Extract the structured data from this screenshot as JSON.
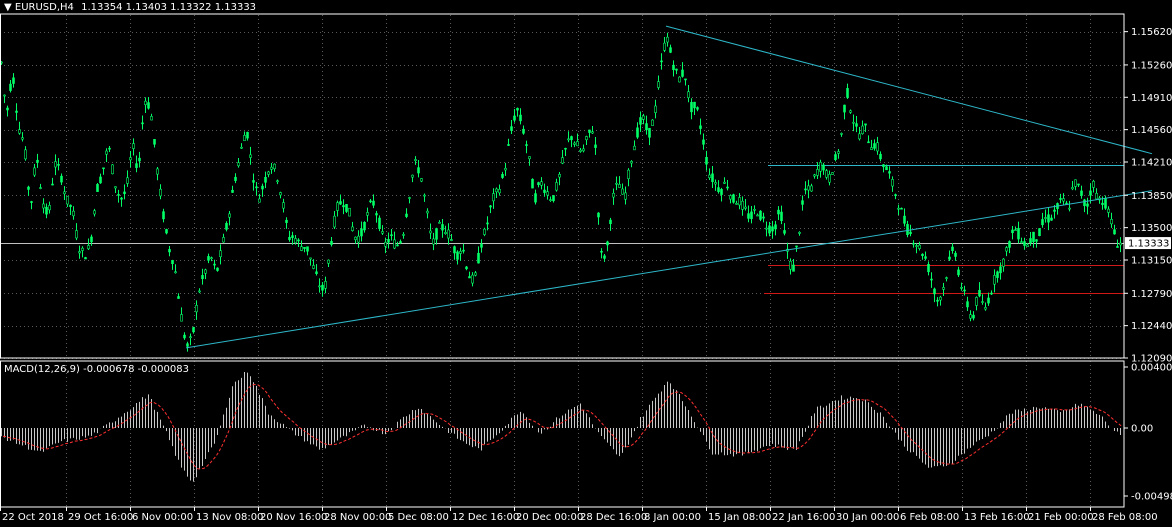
{
  "main_header": {
    "arrow": "▼",
    "symbol": "EURUSD,H4",
    "ohlc": "1.13354 1.13403 1.13322 1.13333"
  },
  "macd_header": {
    "label": "MACD(12,26,9) -0.000678 -0.000083"
  },
  "colors": {
    "background": "#000000",
    "frame": "#ffffff",
    "grid": "#5a5a5a",
    "candles": "#00ff66",
    "trendline": "#2db7c9",
    "resistance": "#2db7c9",
    "support": "#d01818",
    "current_price_line": "#c0c0c0",
    "macd_hist": "#c8c8c8",
    "macd_signal": "#ff3030"
  },
  "price_axis": {
    "ticks": [
      "1.15620",
      "1.15260",
      "1.14910",
      "1.14560",
      "1.14210",
      "1.13850",
      "1.13500",
      "1.13150",
      "1.12790",
      "1.12440",
      "1.12090"
    ],
    "current_price": "1.13333"
  },
  "macd_axis": {
    "ticks": [
      "0.004009",
      "0.00",
      "-0.00498"
    ]
  },
  "time_axis": {
    "labels": [
      "22 Oct 2018",
      "29 Oct 16:00",
      "6 Nov 00:00",
      "13 Nov 08:00",
      "20 Nov 16:00",
      "28 Nov 00:00",
      "5 Dec 08:00",
      "12 Dec 16:00",
      "20 Dec 00:00",
      "28 Dec 16:00",
      "8 Jan 00:00",
      "15 Jan 08:00",
      "22 Jan 16:00",
      "30 Jan 00:00",
      "6 Feb 08:00",
      "13 Feb 16:00",
      "21 Feb 00:00",
      "28 Feb 08:00"
    ]
  },
  "chart_data": {
    "type": "candlestick",
    "symbol": "EURUSD",
    "timeframe": "H4",
    "ylim": [
      1.1209,
      1.158
    ],
    "price_path": [
      [
        0,
        1.154
      ],
      [
        6,
        1.147
      ],
      [
        12,
        1.152
      ],
      [
        18,
        1.146
      ],
      [
        24,
        1.144
      ],
      [
        30,
        1.137
      ],
      [
        36,
        1.143
      ],
      [
        42,
        1.138
      ],
      [
        48,
        1.136
      ],
      [
        54,
        1.142
      ],
      [
        60,
        1.141
      ],
      [
        66,
        1.138
      ],
      [
        72,
        1.137
      ],
      [
        78,
        1.133
      ],
      [
        84,
        1.132
      ],
      [
        90,
        1.133
      ],
      [
        96,
        1.139
      ],
      [
        102,
        1.141
      ],
      [
        108,
        1.144
      ],
      [
        114,
        1.14
      ],
      [
        120,
        1.138
      ],
      [
        126,
        1.139
      ],
      [
        132,
        1.144
      ],
      [
        138,
        1.141
      ],
      [
        144,
        1.149
      ],
      [
        150,
        1.148
      ],
      [
        156,
        1.142
      ],
      [
        162,
        1.137
      ],
      [
        168,
        1.133
      ],
      [
        174,
        1.131
      ],
      [
        180,
        1.126
      ],
      [
        186,
        1.122
      ],
      [
        192,
        1.123
      ],
      [
        198,
        1.128
      ],
      [
        204,
        1.13
      ],
      [
        210,
        1.132
      ],
      [
        216,
        1.13
      ],
      [
        222,
        1.133
      ],
      [
        228,
        1.136
      ],
      [
        234,
        1.14
      ],
      [
        240,
        1.143
      ],
      [
        246,
        1.146
      ],
      [
        252,
        1.141
      ],
      [
        258,
        1.138
      ],
      [
        264,
        1.14
      ],
      [
        270,
        1.142
      ],
      [
        276,
        1.141
      ],
      [
        282,
        1.138
      ],
      [
        288,
        1.134
      ],
      [
        294,
        1.134
      ],
      [
        300,
        1.133
      ],
      [
        306,
        1.133
      ],
      [
        312,
        1.131
      ],
      [
        318,
        1.129
      ],
      [
        324,
        1.128
      ],
      [
        330,
        1.133
      ],
      [
        336,
        1.137
      ],
      [
        342,
        1.138
      ],
      [
        348,
        1.137
      ],
      [
        354,
        1.134
      ],
      [
        360,
        1.134
      ],
      [
        366,
        1.136
      ],
      [
        372,
        1.138
      ],
      [
        378,
        1.136
      ],
      [
        384,
        1.133
      ],
      [
        390,
        1.134
      ],
      [
        396,
        1.133
      ],
      [
        402,
        1.134
      ],
      [
        408,
        1.138
      ],
      [
        414,
        1.142
      ],
      [
        420,
        1.141
      ],
      [
        426,
        1.137
      ],
      [
        432,
        1.133
      ],
      [
        438,
        1.135
      ],
      [
        444,
        1.135
      ],
      [
        450,
        1.134
      ],
      [
        456,
        1.132
      ],
      [
        462,
        1.133
      ],
      [
        468,
        1.13
      ],
      [
        474,
        1.129
      ],
      [
        480,
        1.133
      ],
      [
        486,
        1.135
      ],
      [
        492,
        1.138
      ],
      [
        498,
        1.139
      ],
      [
        504,
        1.141
      ],
      [
        510,
        1.145
      ],
      [
        516,
        1.148
      ],
      [
        522,
        1.146
      ],
      [
        528,
        1.143
      ],
      [
        534,
        1.138
      ],
      [
        540,
        1.14
      ],
      [
        546,
        1.139
      ],
      [
        552,
        1.138
      ],
      [
        558,
        1.14
      ],
      [
        564,
        1.143
      ],
      [
        570,
        1.145
      ],
      [
        576,
        1.144
      ],
      [
        582,
        1.143
      ],
      [
        588,
        1.145
      ],
      [
        594,
        1.146
      ],
      [
        600,
        1.132
      ],
      [
        606,
        1.132
      ],
      [
        612,
        1.138
      ],
      [
        618,
        1.14
      ],
      [
        624,
        1.138
      ],
      [
        630,
        1.142
      ],
      [
        636,
        1.145
      ],
      [
        642,
        1.147
      ],
      [
        648,
        1.145
      ],
      [
        654,
        1.147
      ],
      [
        660,
        1.152
      ],
      [
        666,
        1.156
      ],
      [
        672,
        1.153
      ],
      [
        678,
        1.151
      ],
      [
        684,
        1.152
      ],
      [
        690,
        1.148
      ],
      [
        696,
        1.148
      ],
      [
        702,
        1.145
      ],
      [
        708,
        1.141
      ],
      [
        714,
        1.14
      ],
      [
        720,
        1.139
      ],
      [
        726,
        1.14
      ],
      [
        732,
        1.138
      ],
      [
        738,
        1.138
      ],
      [
        744,
        1.137
      ],
      [
        750,
        1.136
      ],
      [
        756,
        1.137
      ],
      [
        762,
        1.136
      ],
      [
        768,
        1.135
      ],
      [
        774,
        1.135
      ],
      [
        780,
        1.137
      ],
      [
        786,
        1.133
      ],
      [
        792,
        1.13
      ],
      [
        798,
        1.134
      ],
      [
        804,
        1.139
      ],
      [
        810,
        1.139
      ],
      [
        816,
        1.141
      ],
      [
        822,
        1.142
      ],
      [
        828,
        1.14
      ],
      [
        834,
        1.142
      ],
      [
        840,
        1.144
      ],
      [
        846,
        1.15
      ],
      [
        852,
        1.147
      ],
      [
        858,
        1.145
      ],
      [
        864,
        1.146
      ],
      [
        870,
        1.144
      ],
      [
        876,
        1.144
      ],
      [
        882,
        1.142
      ],
      [
        888,
        1.141
      ],
      [
        894,
        1.139
      ],
      [
        900,
        1.137
      ],
      [
        906,
        1.135
      ],
      [
        912,
        1.134
      ],
      [
        918,
        1.133
      ],
      [
        924,
        1.132
      ],
      [
        930,
        1.13
      ],
      [
        936,
        1.127
      ],
      [
        942,
        1.128
      ],
      [
        948,
        1.131
      ],
      [
        954,
        1.133
      ],
      [
        960,
        1.129
      ],
      [
        966,
        1.127
      ],
      [
        972,
        1.125
      ],
      [
        978,
        1.128
      ],
      [
        984,
        1.126
      ],
      [
        990,
        1.128
      ],
      [
        996,
        1.13
      ],
      [
        1002,
        1.131
      ],
      [
        1008,
        1.133
      ],
      [
        1014,
        1.135
      ],
      [
        1020,
        1.134
      ],
      [
        1026,
        1.133
      ],
      [
        1032,
        1.134
      ],
      [
        1038,
        1.134
      ],
      [
        1044,
        1.136
      ],
      [
        1050,
        1.136
      ],
      [
        1056,
        1.137
      ],
      [
        1062,
        1.138
      ],
      [
        1068,
        1.137
      ],
      [
        1074,
        1.14
      ],
      [
        1080,
        1.139
      ],
      [
        1086,
        1.137
      ],
      [
        1092,
        1.14
      ],
      [
        1098,
        1.138
      ],
      [
        1104,
        1.138
      ],
      [
        1110,
        1.136
      ],
      [
        1116,
        1.1335
      ],
      [
        1120,
        1.1333
      ]
    ],
    "trendlines": [
      {
        "name": "lower-trendline",
        "points": [
          [
            186,
            1.122
          ],
          [
            1152,
            1.139
          ]
        ]
      },
      {
        "name": "upper-trendline",
        "points": [
          [
            666,
            1.1568
          ],
          [
            1152,
            1.143
          ]
        ]
      }
    ],
    "horizontal_levels": [
      {
        "name": "resistance-line",
        "price": 1.1418,
        "x_from": 768
      },
      {
        "name": "support-line-upper",
        "price": 1.131,
        "x_from": 768
      },
      {
        "name": "support-line-lower",
        "price": 1.1279,
        "x_from": 764
      },
      {
        "name": "current-price-line",
        "price": 1.13333,
        "x_from": 0
      }
    ],
    "macd": {
      "ylim": [
        -0.00498,
        0.004009
      ],
      "hist_path": [
        [
          0,
          -0.0006
        ],
        [
          40,
          -0.0018
        ],
        [
          60,
          -0.001
        ],
        [
          90,
          -0.0006
        ],
        [
          120,
          0.0008
        ],
        [
          148,
          0.0022
        ],
        [
          165,
          -0.0002
        ],
        [
          180,
          -0.0028
        ],
        [
          192,
          -0.004
        ],
        [
          215,
          -0.001
        ],
        [
          232,
          0.0028
        ],
        [
          248,
          0.0038
        ],
        [
          268,
          0.001
        ],
        [
          290,
          -0.0002
        ],
        [
          320,
          -0.0016
        ],
        [
          345,
          -0.0006
        ],
        [
          365,
          0.0002
        ],
        [
          385,
          -0.0004
        ],
        [
          405,
          0.0008
        ],
        [
          418,
          0.0014
        ],
        [
          440,
          0.0002
        ],
        [
          462,
          -0.001
        ],
        [
          480,
          -0.0016
        ],
        [
          500,
          -0.0002
        ],
        [
          520,
          0.0012
        ],
        [
          540,
          -0.0004
        ],
        [
          560,
          0.0008
        ],
        [
          580,
          0.0016
        ],
        [
          600,
          -0.0006
        ],
        [
          620,
          -0.0022
        ],
        [
          640,
          0.0006
        ],
        [
          668,
          0.0032
        ],
        [
          690,
          0.001
        ],
        [
          712,
          -0.0018
        ],
        [
          740,
          -0.002
        ],
        [
          770,
          -0.0012
        ],
        [
          795,
          -0.0016
        ],
        [
          815,
          0.0012
        ],
        [
          840,
          0.002
        ],
        [
          860,
          0.002
        ],
        [
          880,
          0.001
        ],
        [
          905,
          -0.0014
        ],
        [
          930,
          -0.003
        ],
        [
          950,
          -0.0026
        ],
        [
          970,
          -0.0014
        ],
        [
          990,
          -0.0004
        ],
        [
          1010,
          0.001
        ],
        [
          1040,
          0.0014
        ],
        [
          1060,
          0.001
        ],
        [
          1080,
          0.0016
        ],
        [
          1100,
          0.0008
        ],
        [
          1120,
          -0.0006
        ]
      ]
    }
  }
}
